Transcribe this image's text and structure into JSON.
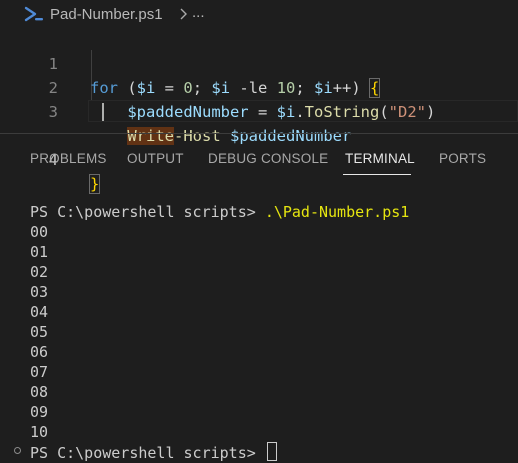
{
  "breadcrumb": {
    "file_icon": "powershell-icon",
    "file": "Pad-Number.ps1",
    "separator_icon": "chevron-right-icon",
    "ellipsis": "..."
  },
  "editor": {
    "lines": [
      {
        "number": "1",
        "text": "for ($i = 0; $i -le 10; $i++) {"
      },
      {
        "number": "2",
        "text": "    $paddedNumber = $i.ToString(\"D2\")"
      },
      {
        "number": "3",
        "text": "    Write-Host $paddedNumber"
      },
      {
        "number": "4",
        "text": "}"
      }
    ],
    "active_line": 4
  },
  "panel": {
    "tabs": [
      "PROBLEMS",
      "OUTPUT",
      "DEBUG CONSOLE",
      "TERMINAL",
      "PORTS"
    ],
    "active_tab": "TERMINAL"
  },
  "terminal": {
    "prompt": "PS C:\\powershell scripts> ",
    "command": ".\\Pad-Number.ps1",
    "output": [
      "00",
      "01",
      "02",
      "03",
      "04",
      "05",
      "06",
      "07",
      "08",
      "09",
      "10"
    ],
    "final_prompt": "PS C:\\powershell scripts> "
  },
  "colors": {
    "background": "#1e1e1e",
    "keyword": "#569cd6",
    "variable": "#9cdcfe",
    "number": "#b5cea8",
    "string": "#ce9178",
    "function": "#dcdcaa",
    "brace": "#ffd700",
    "command": "#e5e510"
  }
}
